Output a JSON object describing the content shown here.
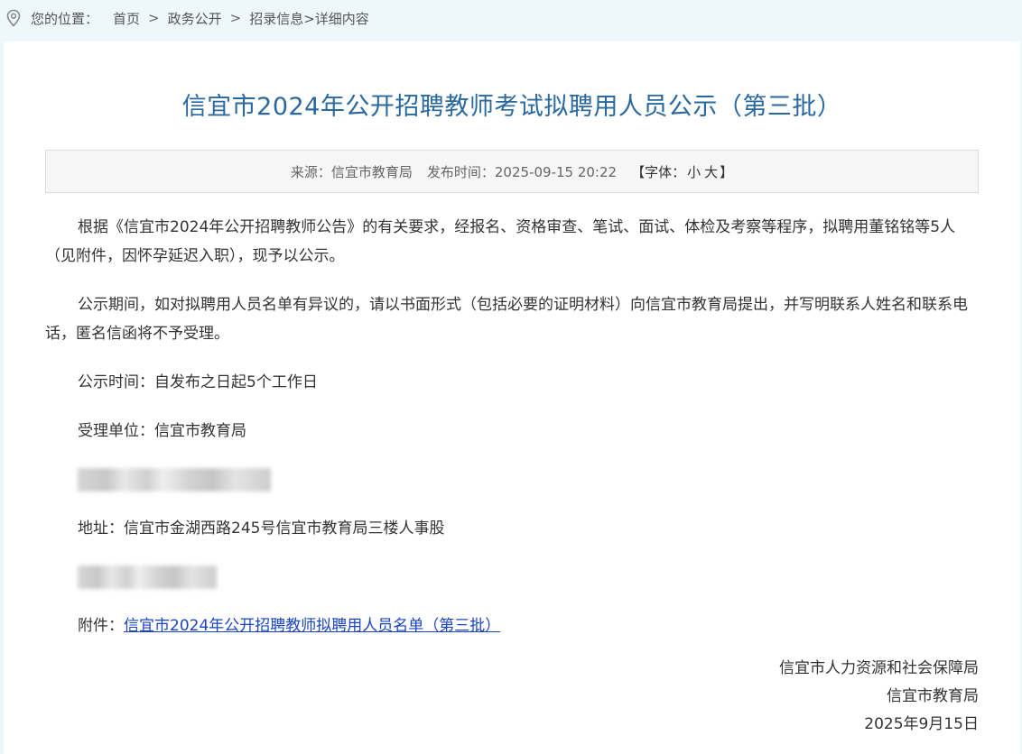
{
  "breadcrumb": {
    "location_label": "您的位置：",
    "items": [
      "首页",
      "政务公开",
      "招录信息"
    ],
    "separator": ">",
    "current": ">详细内容"
  },
  "article": {
    "title": "信宜市2024年公开招聘教师考试拟聘用人员公示（第三批）",
    "meta": {
      "source": "来源：信宜市教育局",
      "publish_time": "发布时间：2025-09-15 20:22",
      "font_label_open": "【字体：",
      "font_small": "小",
      "font_large": "大",
      "font_label_close": "】"
    },
    "paragraphs": [
      "根据《信宜市2024年公开招聘教师公告》的有关要求，经报名、资格审查、笔试、面试、体检及考察等程序，拟聘用董铭铭等5人（见附件，因怀孕延迟入职），现予以公示。",
      "公示期间，如对拟聘用人员名单有异议的，请以书面形式（包括必要的证明材料）向信宜市教育局提出，并写明联系人姓名和联系电话，匿名信函将不予受理。",
      "公示时间：自发布之日起5个工作日",
      "受理单位：信宜市教育局"
    ],
    "address": "地址：信宜市金湖西路245号信宜市教育局三楼人事股",
    "attachment_label": "附件：",
    "attachment_link": "信宜市2024年公开招聘教师拟聘用人员名单（第三批）"
  },
  "signature": {
    "org1": "信宜市人力资源和社会保障局",
    "org2": "信宜市教育局",
    "date": "2025年9月15日"
  },
  "colors": {
    "title": "#2a69a0",
    "link": "#1a44c4",
    "background": "#eef7fb"
  }
}
